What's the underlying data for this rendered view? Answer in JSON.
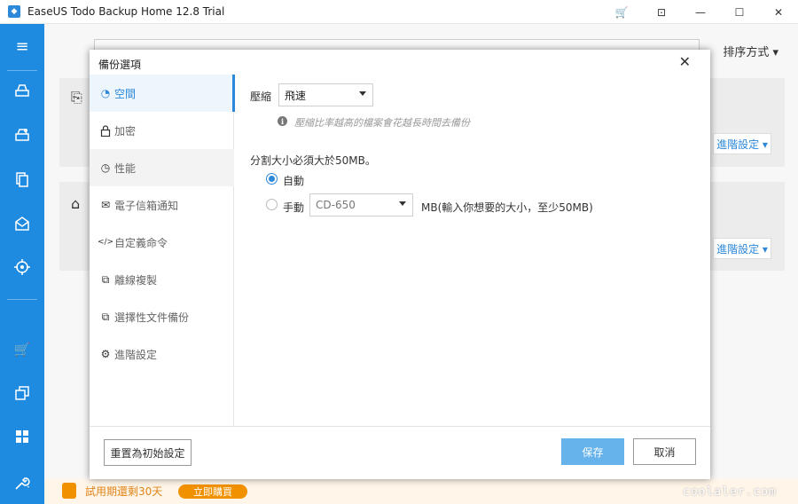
{
  "window": {
    "title": "EaseUS Todo Backup Home 12.8 Trial",
    "controls": {
      "cart": "🛒",
      "restore": "⊡",
      "minimize": "—",
      "maximize": "☐",
      "close": "✕"
    }
  },
  "sidebar": {
    "icons": [
      "menu-icon",
      "backup-drive-icon",
      "system-backup-icon",
      "file-backup-icon",
      "mail-backup-icon",
      "target-icon",
      "cart-icon",
      "clone-icon",
      "apps-icon",
      "tools-icon"
    ]
  },
  "background": {
    "sort_label": "排序方式 ▾",
    "advanced_label_1": "進階設定 ▾",
    "advanced_label_2": "進階設定 ▾",
    "trial_text": "試用期還剩30天",
    "buy_label": "立即購買",
    "watermark": "coolaler.com"
  },
  "dialog": {
    "title": "備份選項",
    "close": "✕",
    "nav": [
      {
        "label": "空間",
        "icon": "◔"
      },
      {
        "label": "加密",
        "icon": "🔒"
      },
      {
        "label": "性能",
        "icon": "◷"
      },
      {
        "label": "電子信箱通知",
        "icon": "✉"
      },
      {
        "label": "自定義命令",
        "icon": "</>"
      },
      {
        "label": "離線複製",
        "icon": "⧉"
      },
      {
        "label": "選擇性文件備份",
        "icon": "⧉"
      },
      {
        "label": "進階設定",
        "icon": "⚙"
      }
    ],
    "compression": {
      "label": "壓縮",
      "value": "飛速",
      "hint": "壓縮比率越高的檔案會花越長時間去備份"
    },
    "split": {
      "label": "分割大小必須大於50MB。",
      "auto_label": "自動",
      "manual_label": "手動",
      "manual_value": "CD-650",
      "manual_hint": "MB(輸入你想要的大小，至少50MB)",
      "selected": "auto"
    },
    "footer": {
      "reset_label": "重置為初始設定",
      "save_label": "保存",
      "cancel_label": "取消"
    }
  }
}
